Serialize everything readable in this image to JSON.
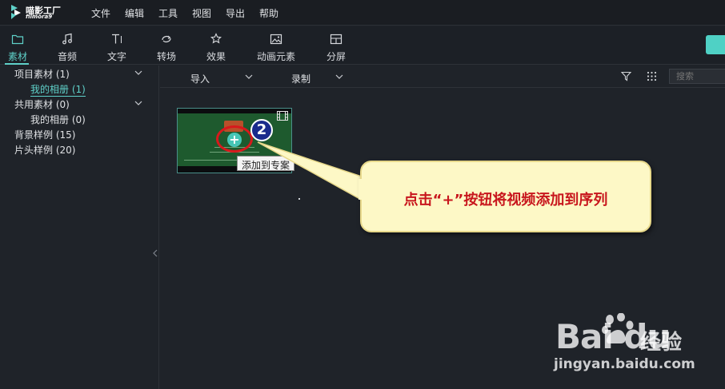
{
  "app": {
    "name_cn": "喵影工厂",
    "name_en": "filmora9"
  },
  "menu": [
    "文件",
    "编辑",
    "工具",
    "视图",
    "导出",
    "帮助"
  ],
  "toolbar": {
    "tools": [
      {
        "label": "素材",
        "icon": "folder-icon",
        "active": true
      },
      {
        "label": "音频",
        "icon": "music-note-icon",
        "active": false
      },
      {
        "label": "文字",
        "icon": "text-icon",
        "active": false
      },
      {
        "label": "转场",
        "icon": "transition-icon",
        "active": false
      },
      {
        "label": "效果",
        "icon": "effects-icon",
        "active": false
      },
      {
        "label": "动画元素",
        "icon": "image-icon",
        "active": false
      },
      {
        "label": "分屏",
        "icon": "split-screen-icon",
        "active": false
      }
    ],
    "accent": "#5fd1c9"
  },
  "sidebar": {
    "items": [
      {
        "label": "项目素材 (1)",
        "expandable": true
      },
      {
        "label": "我的相册 (1)",
        "selected": true
      },
      {
        "label": "共用素材 (0)",
        "expandable": true
      },
      {
        "label": "我的相册 (0)"
      },
      {
        "label": "背景样例 (15)"
      },
      {
        "label": "片头样例 (20)"
      }
    ]
  },
  "content": {
    "import_label": "导入",
    "record_label": "录制",
    "search_placeholder": "搜索",
    "tooltip": "添加到专案",
    "step_number": "2"
  },
  "callout": {
    "text": "点击“+”按钮将视频添加到序列"
  },
  "watermark": {
    "brand": "Bai du",
    "brand_cn": "经验",
    "url": "jingyan.baidu.com"
  }
}
